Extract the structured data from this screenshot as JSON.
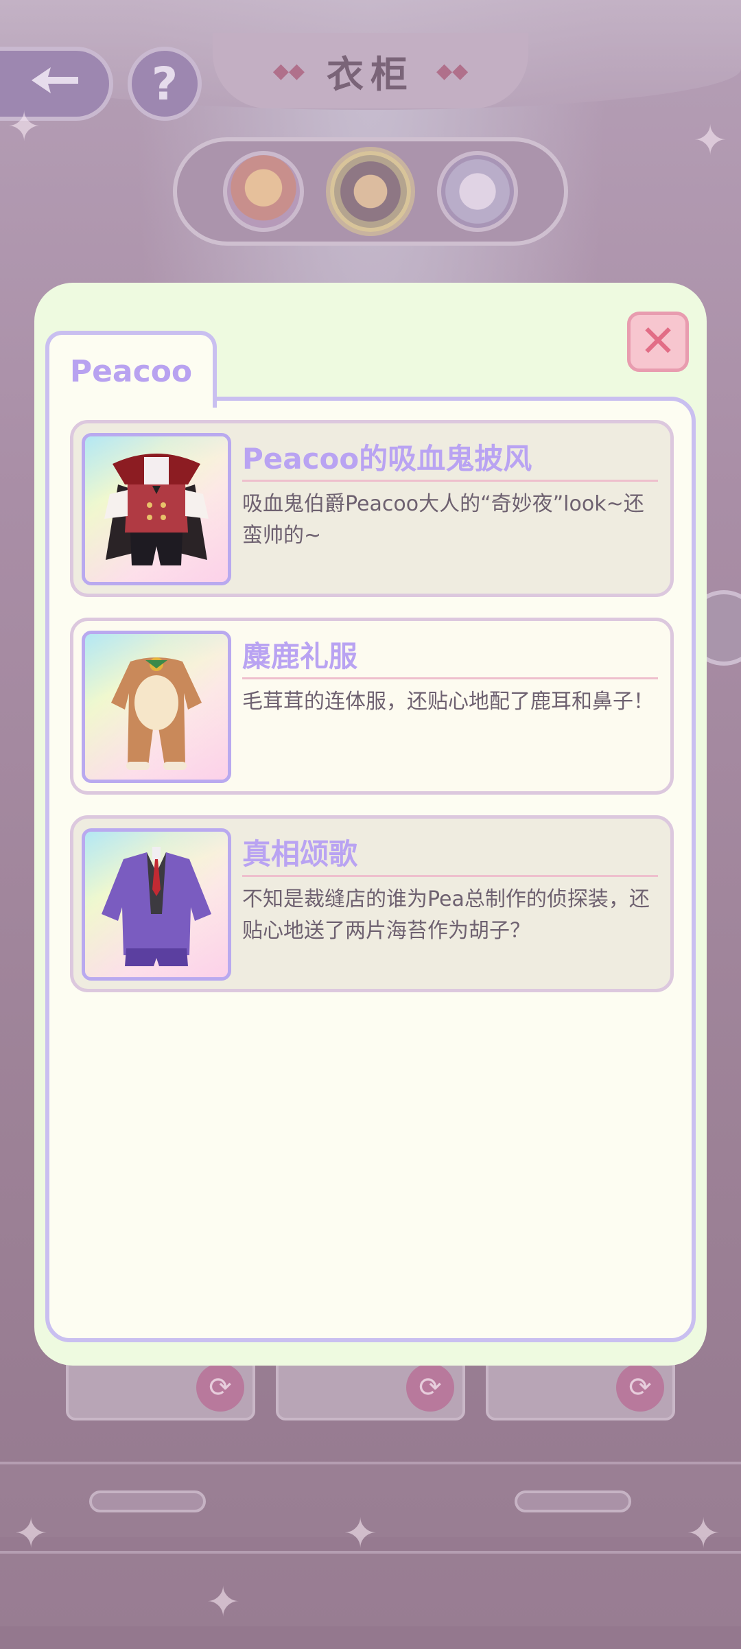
{
  "background": {
    "title": "衣柜",
    "back_icon": "back-arrow-icon",
    "help_icon": "help-question-icon",
    "characters": [
      {
        "name": "character-1",
        "selected": false
      },
      {
        "name": "character-2",
        "selected": true
      },
      {
        "name": "character-3",
        "selected": false
      }
    ]
  },
  "modal": {
    "tab_label": "Peacoo",
    "close_icon": "close-icon",
    "items": [
      {
        "name": "Peacoo的吸血鬼披风",
        "description": "吸血鬼伯爵Peacoo大人的“奇妙夜”look~还蛮帅的~"
      },
      {
        "name": "麋鹿礼服",
        "description": "毛茸茸的连体服，还贴心地配了鹿耳和鼻子！"
      },
      {
        "name": "真相颂歌",
        "description": "不知是裁缝店的谁为Pea总制作的侦探装，还贴心地送了两片海苔作为胡子？"
      }
    ]
  },
  "colors": {
    "modal_bg": "#eefae0",
    "panel_bg": "#fdfdf2",
    "accent_purple": "#b9a3f2",
    "close_pink": "#e26d86"
  }
}
